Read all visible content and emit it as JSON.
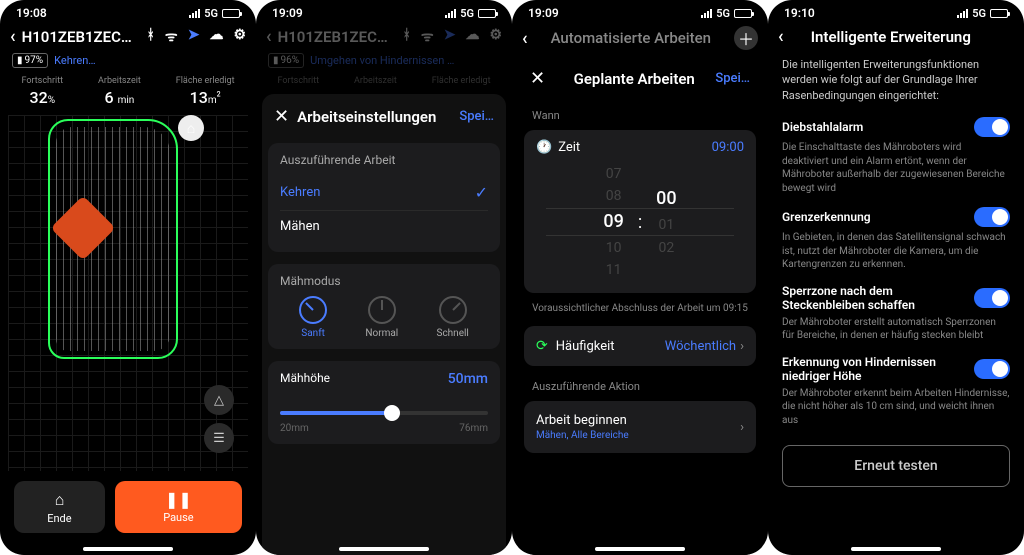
{
  "status": {
    "times": [
      "19:08",
      "19:09",
      "19:09",
      "19:10"
    ],
    "net": "5G"
  },
  "s1": {
    "title": "H101ZEB1ZEC…",
    "battery": "97%",
    "status_link": "Kehren…",
    "stats": {
      "progress_lbl": "Fortschritt",
      "progress_val": "32",
      "progress_unit": "%",
      "time_lbl": "Arbeitszeit",
      "time_val": "6",
      "time_unit": "min",
      "area_lbl": "Fläche erledigt",
      "area_val": "13",
      "area_unit": "m",
      "area_sup": "2"
    },
    "btn_end": "Ende",
    "btn_pause": "Pause"
  },
  "s2": {
    "title": "H101ZEB1ZEC…",
    "battery": "96%",
    "status_link": "Umgehen von Hindernissen …",
    "stats": {
      "progress_lbl": "Fortschritt",
      "time_lbl": "Arbeitszeit",
      "area_lbl": "Fläche erledigt"
    },
    "sheet_title": "Arbeitseinstellungen",
    "sheet_action": "Spei…",
    "task_section": "Auszuführende Arbeit",
    "task_kehren": "Kehren",
    "task_maehen": "Mähen",
    "mode_section": "Mähmodus",
    "mode_soft": "Sanft",
    "mode_normal": "Normal",
    "mode_fast": "Schnell",
    "height_section": "Mähhöhe",
    "height_val": "50mm",
    "height_min": "20mm",
    "height_max": "76mm"
  },
  "s3": {
    "nav_title": "Automatisierte Arbeiten",
    "sheet_title": "Geplante Arbeiten",
    "sheet_action": "Spei…",
    "when_lbl": "Wann",
    "time_lbl": "Zeit",
    "time_val": "09:00",
    "picker_hours": [
      "07",
      "08",
      "09",
      "10",
      "11"
    ],
    "picker_mins": [
      "",
      "",
      "00",
      "01",
      "02"
    ],
    "eta": "Voraussichtlicher Abschluss der Arbeit um 09:15",
    "freq_lbl": "Häufigkeit",
    "freq_val": "Wöchentlich",
    "action_section": "Auszuführende Aktion",
    "action_title": "Arbeit beginnen",
    "action_sub": "Mähen, Alle Bereiche"
  },
  "s4": {
    "nav_title": "Intelligente Erweiterung",
    "intro": "Die intelligenten Erweiterungsfunktionen werden wie folgt auf der Grundlage Ihrer Rasenbedingungen eingerichtet:",
    "t1": "Diebstahlalarm",
    "d1": "Die Einschalttaste des Mähroboters wird deaktiviert und ein Alarm ertönt, wenn der Mähroboter außerhalb der zugewiesenen Bereiche bewegt wird",
    "t2": "Grenzerkennung",
    "d2": "In Gebieten, in denen das Satellitensignal schwach ist, nutzt der Mähroboter die Kamera, um die Kartengrenzen zu erkennen.",
    "t3": "Sperrzone nach dem Steckenbleiben schaffen",
    "d3": "Der Mähroboter erstellt automatisch Sperrzonen für Bereiche, in denen er häufig stecken bleibt",
    "t4": "Erkennung von Hindernissen niedriger Höhe",
    "d4": "Der Mähroboter erkennt beim Arbeiten Hindernisse, die nicht höher als 10 cm sind, und weicht ihnen aus",
    "retest": "Erneut testen"
  }
}
